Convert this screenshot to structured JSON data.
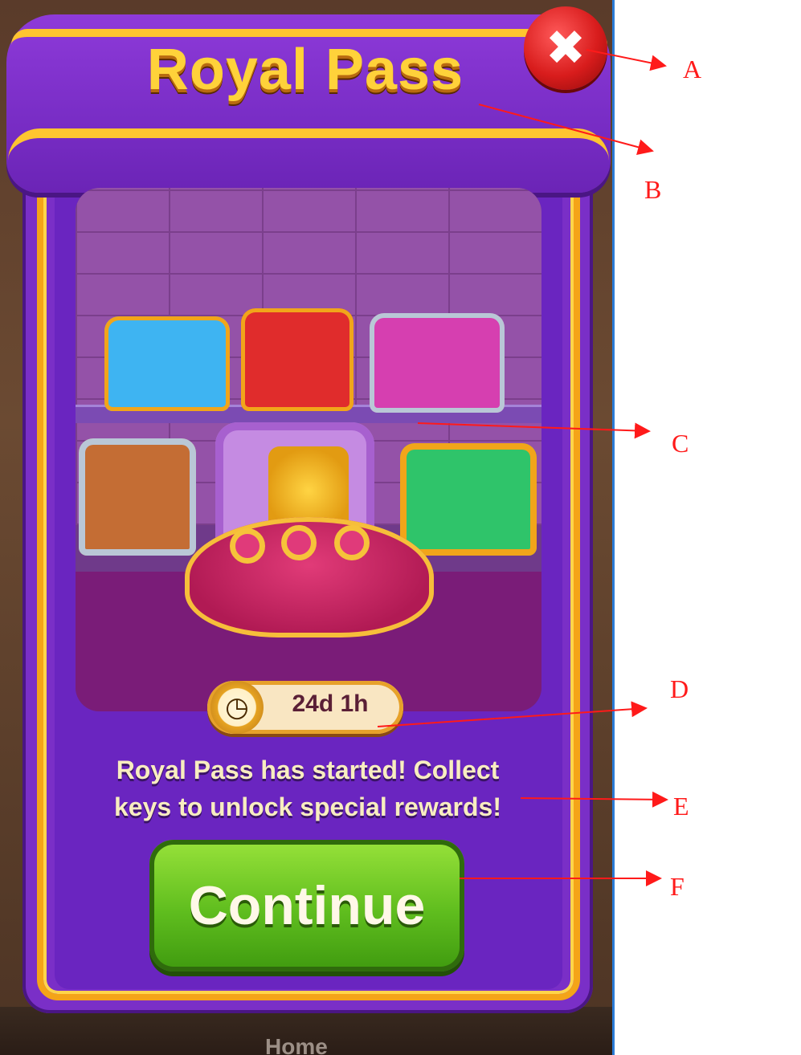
{
  "dialog": {
    "title": "Royal Pass",
    "close_symbol": "✖",
    "timer_icon_symbol": "◷",
    "timer": "24d 1h",
    "message_lines": [
      "Royal Pass has started! Collect",
      "keys to unlock special rewards!"
    ],
    "continue_label": "Continue"
  },
  "background": {
    "bottom_nav_label": "Home"
  },
  "annotations": {
    "labels": [
      "A",
      "B",
      "C",
      "D",
      "E",
      "F"
    ],
    "color": "#ff1a1a"
  },
  "colors": {
    "panel_purple": "#7a2fc7",
    "gold_trim": "#f4a418",
    "title_yellow": "#ffd23a",
    "close_red": "#d81c1c",
    "continue_green": "#5fbd1e"
  }
}
